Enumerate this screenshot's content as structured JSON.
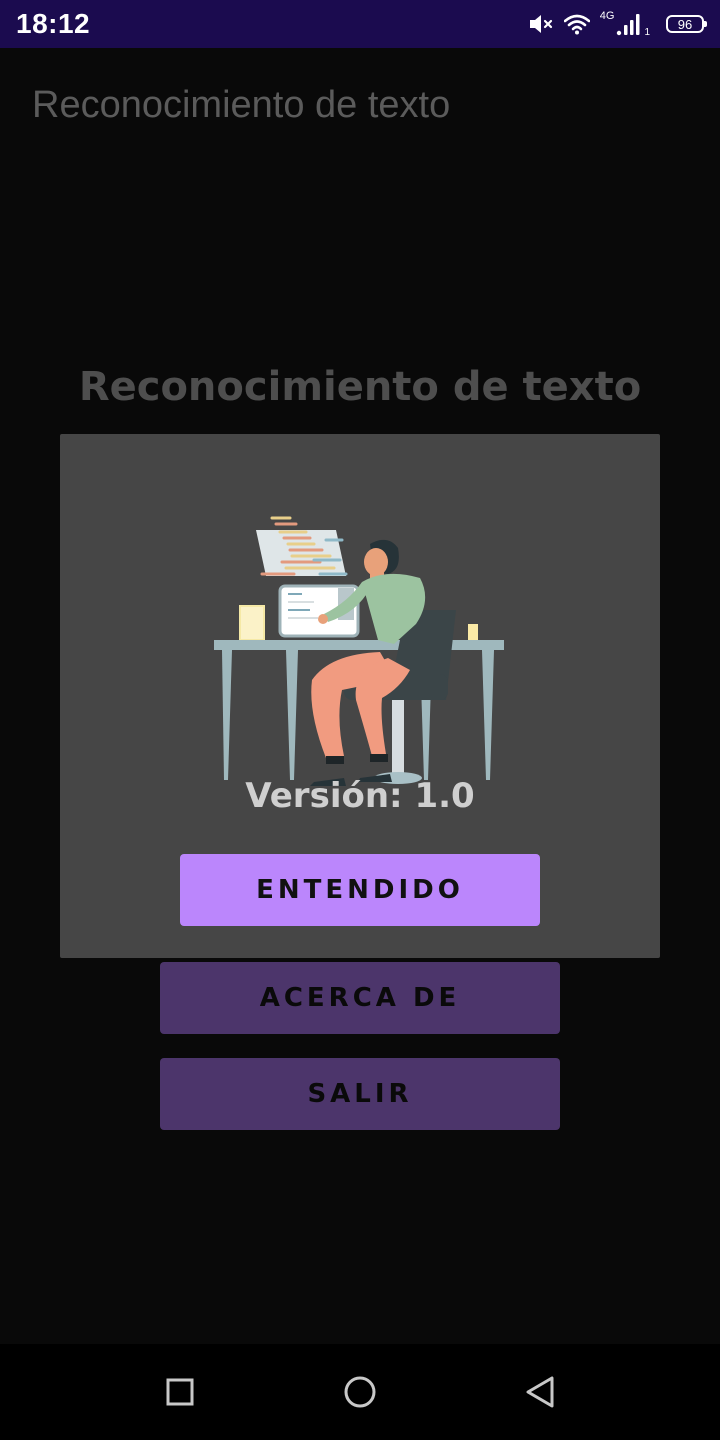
{
  "status_bar": {
    "time": "18:12",
    "network": "4G",
    "sim_slot": "1",
    "battery": "96",
    "icons": [
      "mute-icon",
      "wifi-icon",
      "signal-icon",
      "battery-icon"
    ]
  },
  "app_bar": {
    "title": "Reconocimiento de texto"
  },
  "main": {
    "title": "Reconocimiento de texto",
    "about_label": "ACERCA DE",
    "exit_label": "SALIR"
  },
  "dialog": {
    "illustration": "person-at-desk-coding-illustration",
    "version": "Versión: 1.0",
    "ok_label": "ENTENDIDO"
  },
  "nav_bar": {
    "icons": [
      "recent-apps-icon",
      "home-icon",
      "back-icon"
    ]
  },
  "colors": {
    "status_bar": "#1b0b4f",
    "background": "#090909",
    "dialog": "#464646",
    "accent": "#bb86fc",
    "accent_dim": "#4c356b"
  }
}
